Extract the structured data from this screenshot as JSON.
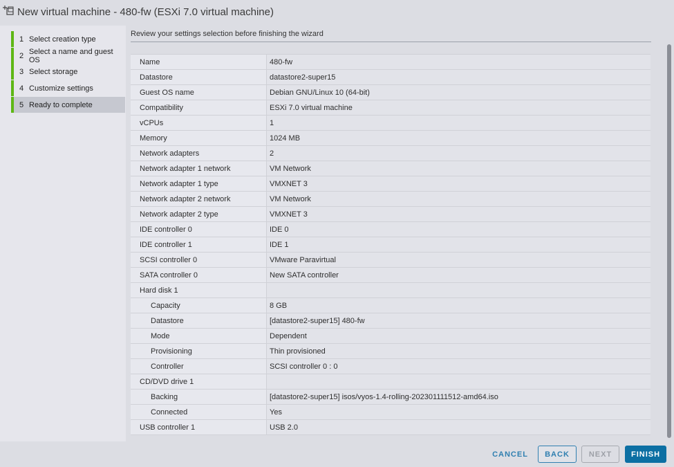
{
  "window": {
    "title": "New virtual machine - 480-fw (ESXi 7.0 virtual machine)",
    "icon": "new-vm-icon"
  },
  "sidebar": {
    "steps": [
      {
        "num": "1",
        "label": "Select creation type",
        "active": false
      },
      {
        "num": "2",
        "label": "Select a name and guest OS",
        "active": false
      },
      {
        "num": "3",
        "label": "Select storage",
        "active": false
      },
      {
        "num": "4",
        "label": "Customize settings",
        "active": false
      },
      {
        "num": "5",
        "label": "Ready to complete",
        "active": true
      }
    ],
    "accent_color": "#5eb715"
  },
  "main": {
    "subtitle": "Review your settings selection before finishing the wizard",
    "rows": [
      {
        "label": "Name",
        "value": "480-fw"
      },
      {
        "label": "Datastore",
        "value": "datastore2-super15"
      },
      {
        "label": "Guest OS name",
        "value": "Debian GNU/Linux 10 (64-bit)"
      },
      {
        "label": "Compatibility",
        "value": "ESXi 7.0 virtual machine"
      },
      {
        "label": "vCPUs",
        "value": "1"
      },
      {
        "label": "Memory",
        "value": "1024 MB"
      },
      {
        "label": "Network adapters",
        "value": "2"
      },
      {
        "label": "Network adapter 1 network",
        "value": "VM Network"
      },
      {
        "label": "Network adapter 1 type",
        "value": "VMXNET 3"
      },
      {
        "label": "Network adapter 2 network",
        "value": "VM Network"
      },
      {
        "label": "Network adapter 2 type",
        "value": "VMXNET 3"
      },
      {
        "label": "IDE controller 0",
        "value": "IDE 0"
      },
      {
        "label": "IDE controller 1",
        "value": "IDE 1"
      },
      {
        "label": "SCSI controller 0",
        "value": "VMware Paravirtual"
      },
      {
        "label": "SATA controller 0",
        "value": "New SATA controller"
      },
      {
        "label": "Hard disk 1",
        "value": ""
      },
      {
        "label": "Capacity",
        "value": "8 GB",
        "indent": true
      },
      {
        "label": "Datastore",
        "value": "[datastore2-super15] 480-fw",
        "indent": true
      },
      {
        "label": "Mode",
        "value": "Dependent",
        "indent": true
      },
      {
        "label": "Provisioning",
        "value": "Thin provisioned",
        "indent": true
      },
      {
        "label": "Controller",
        "value": "SCSI controller 0 : 0",
        "indent": true
      },
      {
        "label": "CD/DVD drive 1",
        "value": ""
      },
      {
        "label": "Backing",
        "value": "[datastore2-super15] isos/vyos-1.4-rolling-202301111512-amd64.iso",
        "indent": true
      },
      {
        "label": "Connected",
        "value": "Yes",
        "indent": true
      },
      {
        "label": "USB controller 1",
        "value": "USB 2.0"
      }
    ]
  },
  "footer": {
    "cancel_label": "CANCEL",
    "back_label": "BACK",
    "next_label": "NEXT",
    "finish_label": "FINISH",
    "primary_color": "#0c6fa3"
  }
}
